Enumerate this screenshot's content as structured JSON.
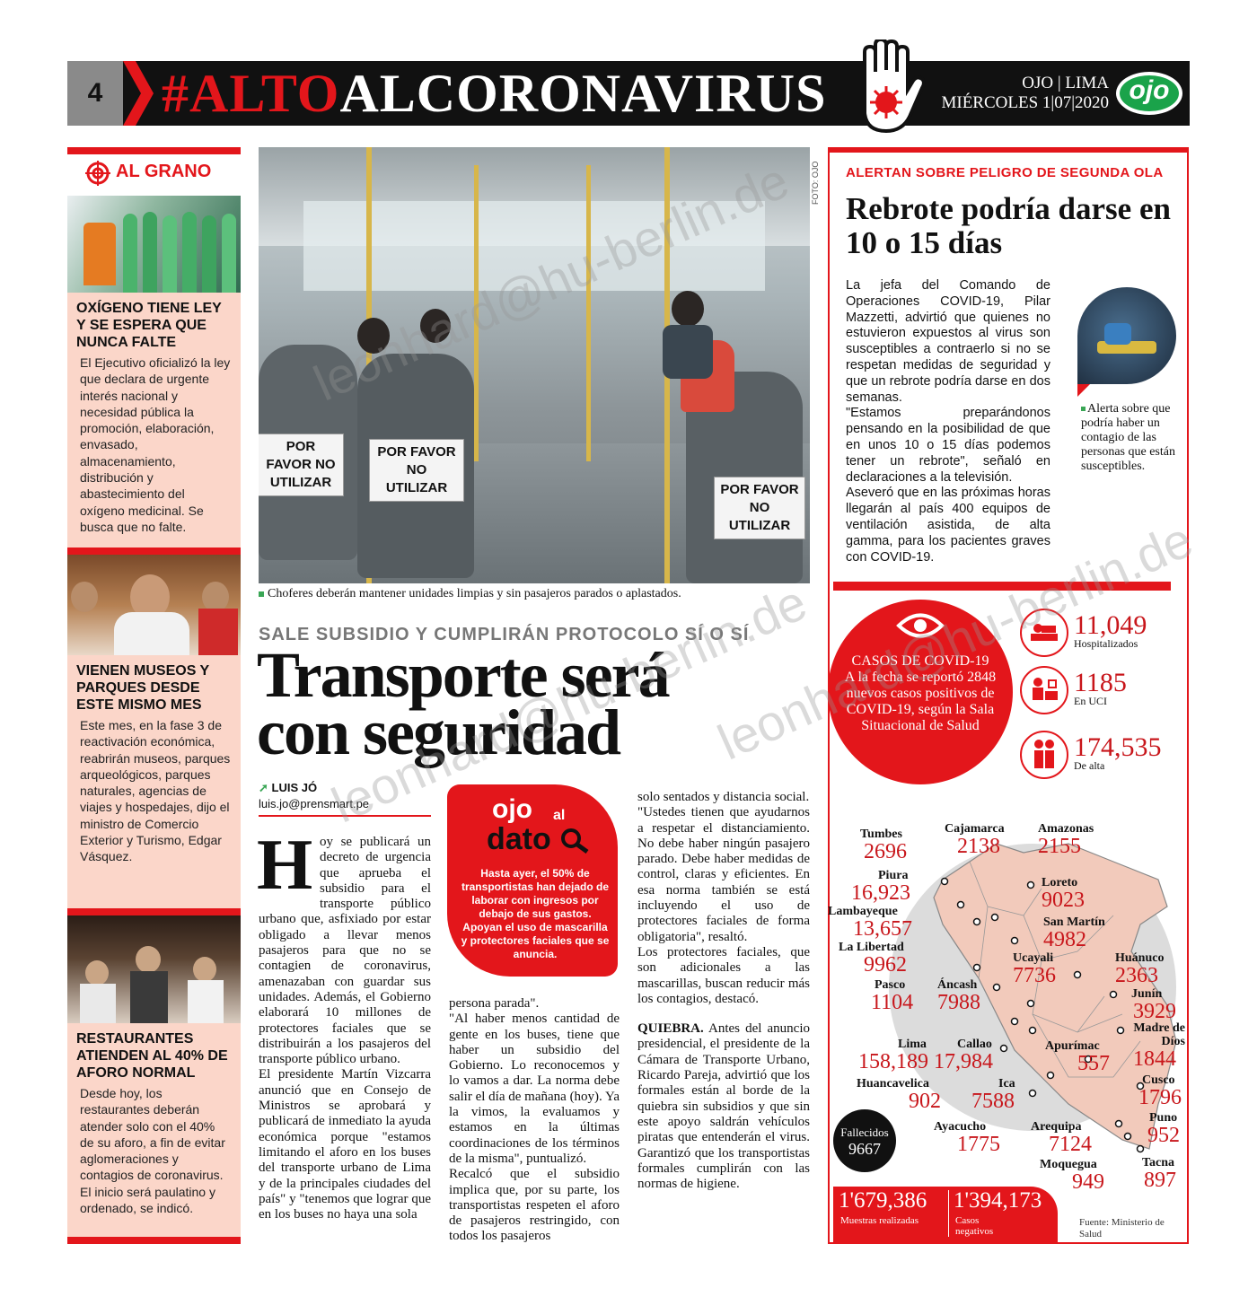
{
  "header": {
    "page_number": "4",
    "title_red": "#ALTO",
    "title_white": "ALCORONAVIRUS",
    "meta_line1": "OJO | LIMA",
    "meta_line2": "MIÉRCOLES 1|07|2020",
    "logo_text": "ojo"
  },
  "left_column": {
    "section_label": "AL GRANO",
    "items": [
      {
        "title": "OXÍGENO TIENE LEY Y SE ESPERA QUE NUNCA FALTE",
        "body": "El Ejecutivo oficializó la ley que declara de urgente interés nacional y necesidad pública la promoción, elaboración, envasado, almacenamiento, distribución y abastecimiento del oxígeno medicinal. Se busca que no falte."
      },
      {
        "title": "VIENEN MUSEOS Y PARQUES DESDE ESTE MISMO MES",
        "body": "Este mes, en la fase 3 de reactivación económica, reabrirán museos, parques arqueológicos, parques naturales, agencias de viajes y hospedajes, dijo el ministro de Comercio Exterior y Turismo, Edgar Vásquez."
      },
      {
        "title": "RESTAURANTES ATIENDEN AL 40% DE AFORO NORMAL",
        "body": "Desde hoy, los restaurantes deberán atender solo con el 40% de su aforo, a fin de evitar aglomeraciones y contagios de coronavirus. El inicio será paulatino y ordenado, se indicó."
      }
    ]
  },
  "main_story": {
    "photo_credit": "FOTO: OJO",
    "sign_text": "POR FAVOR NO UTILIZAR",
    "caption": "Choferes deberán mantener unidades limpias y sin pasajeros parados o aplastados.",
    "kicker": "SALE SUBSIDIO Y CUMPLIRÁN PROTOCOLO SÍ O SÍ",
    "headline_line1": "Transporte será",
    "headline_line2": "con seguridad",
    "author": "LUIS JÓ",
    "email": "luis.jo@prensmart.pe",
    "dropcap": "H",
    "col1_lead": "oy se publicará un decreto de urgencia que aprueba el subsidio para el transporte público urbano que, asfixiado por estar obligado a llevar menos pasajeros para que no se contagien de coronavirus, amenazaban con guardar sus unidades. Además, el Gobierno elaborará 10 millones de protectores faciales que se distribuirán a los pasajeros del transporte público urbano.",
    "col1_rest": "El presidente Martín Vizcarra anunció que en Consejo de Ministros se aprobará y publicará de inmediato la ayuda económica porque \"estamos limitando el aforo en los buses del transporte urbano de Lima y de la principales ciudades del país\" y \"tenemos que lograr que en los buses no haya una sola",
    "col2": "persona parada\".\n\"Al haber menos cantidad de gente en los buses, tiene que haber un subsidio del Gobierno. Lo reconocemos y lo vamos a dar. La norma debe salir el día de mañana (hoy). Ya la vimos, la evaluamos y estamos en la últimas coordinaciones de los términos de la misma\", puntualizó.\nRecalcó que el subsidio implica que, por su parte, los transportistas respeten el aforo de pasajeros restringido, con todos los pasajeros",
    "col3_a": "solo sentados y distancia social.\n\"Ustedes tienen que ayudarnos a respetar el distanciamiento. No debe haber ningún pasajero parado. Debe haber medidas de control, claras y eficientes. En esa norma también se está incluyendo el uso de protectores faciales de forma obligatoria\", resaltó.\nLos protectores faciales, que son adicionales a las mascarillas, buscan reducir más los contagios, destacó.",
    "col3_b_label": "QUIEBRA.",
    "col3_b": " Antes del anuncio presidencial, el presidente de la Cámara de Transporte Urbano, Ricardo Pareja, advirtió que los formales están al borde de la quiebra sin subsidios y que sin este apoyo saldrán vehículos piratas que entenderán el virus. Garantizó que los transportistas formales cumplirán con las normas de higiene."
  },
  "ojo_al_dato": {
    "ojo": "ojo",
    "al": "al",
    "dato": "dato",
    "text": "Hasta ayer, el 50% de transportistas han dejado de laborar con ingresos por debajo de sus gastos. Apoyan el uso de mascarilla y protectores faciales que se anuncia."
  },
  "right_box": {
    "kicker": "ALERTAN SOBRE PELIGRO DE SEGUNDA OLA",
    "title": "Rebrote podría darse en 10 o 15 días",
    "body": "La jefa del Comando de Operaciones COVID-19, Pilar Mazzetti, advirtió que quienes no estuvieron expuestos al virus son susceptibles a contraerlo si no se respetan medidas de seguridad y que un rebrote podría darse en dos semanas.\n\"Estamos preparándonos pensando en la posibilidad de que en unos 10 o 15 días podemos tener un rebrote\", señaló en declaraciones a la televisión.\nAseveró que en las próximas horas llegarán al país 400 equipos de ventilación asistida, de alta gamma, para los pacientes graves con COVID-19.",
    "photo_caption": "Alerta sobre que podría haber un contagio de las personas que están susceptibles."
  },
  "covid_stats": {
    "circle_title": "CASOS DE COVID-19",
    "circle_text": "A la fecha se reportó 2848 nuevos casos positivos de COVID-19, según la Sala Situacional de Salud",
    "stats": [
      {
        "value": "11,049",
        "label": "Hospitalizados",
        "icon": "hospital-bed-icon"
      },
      {
        "value": "1185",
        "label": "En UCI",
        "icon": "icu-icon"
      },
      {
        "value": "174,535",
        "label": "De alta",
        "icon": "discharged-icon"
      }
    ],
    "regions": [
      {
        "name": "Tumbes",
        "value": "2696"
      },
      {
        "name": "Cajamarca",
        "value": "2138"
      },
      {
        "name": "Amazonas",
        "value": "2155"
      },
      {
        "name": "Piura",
        "value": "16,923"
      },
      {
        "name": "Loreto",
        "value": "9023"
      },
      {
        "name": "Lambayeque",
        "value": "13,657"
      },
      {
        "name": "San Martín",
        "value": "4982"
      },
      {
        "name": "La Libertad",
        "value": "9962"
      },
      {
        "name": "Ucayali",
        "value": "7736"
      },
      {
        "name": "Huánuco",
        "value": "2363"
      },
      {
        "name": "Pasco",
        "value": "1104"
      },
      {
        "name": "Áncash",
        "value": "7988"
      },
      {
        "name": "Junín",
        "value": "3929"
      },
      {
        "name": "Madre de Díos",
        "value": "1844"
      },
      {
        "name": "Lima",
        "value": "158,189"
      },
      {
        "name": "Callao",
        "value": "17,984"
      },
      {
        "name": "Apurímac",
        "value": "557"
      },
      {
        "name": "Huancavelica",
        "value": "902"
      },
      {
        "name": "Ica",
        "value": "7588"
      },
      {
        "name": "Cusco",
        "value": "1796"
      },
      {
        "name": "Puno",
        "value": "952"
      },
      {
        "name": "Ayacucho",
        "value": "1775"
      },
      {
        "name": "Arequipa",
        "value": "7124"
      },
      {
        "name": "Moquegua",
        "value": "949"
      },
      {
        "name": "Tacna",
        "value": "897"
      }
    ],
    "fallecidos_label": "Fallecidos",
    "fallecidos_value": "9667",
    "muestras_value": "1'679,386",
    "muestras_label": "Muestras realizadas",
    "negativos_value": "1'394,173",
    "negativos_label": "Casos negativos",
    "fuente": "Fuente: Ministerio de Salud"
  },
  "watermark": "leonhard@hu-berlin.de",
  "colors": {
    "accent_red": "#e3161b",
    "pink_bg": "#fbd6c9",
    "header_black": "#111111"
  }
}
